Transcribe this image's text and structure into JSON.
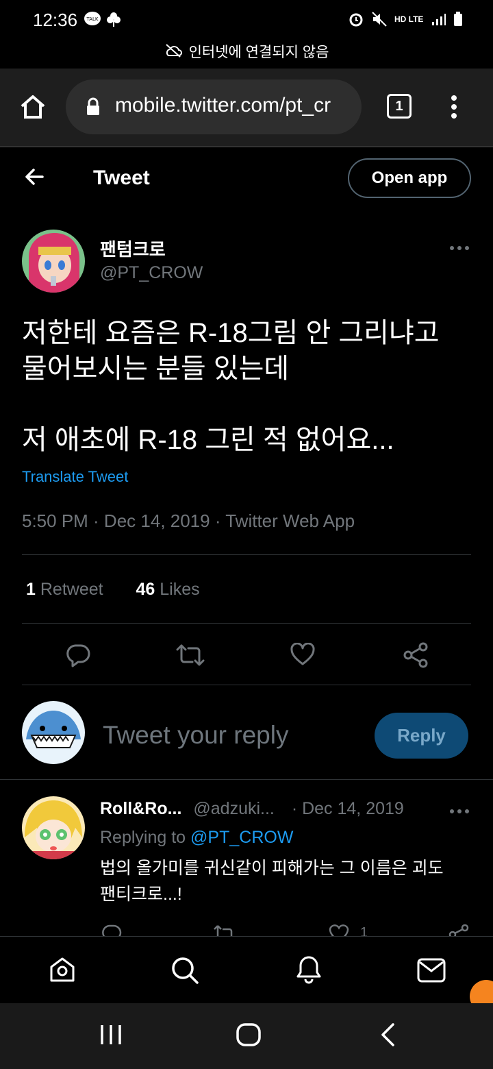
{
  "status_bar": {
    "time": "12:36",
    "network": "HD LTE"
  },
  "offline_banner": "인터넷에 연결되지 않음",
  "browser": {
    "url": "mobile.twitter.com/pt_cr",
    "tab_count": "1"
  },
  "header": {
    "title": "Tweet",
    "open_app": "Open app"
  },
  "tweet": {
    "display_name": "팬텀크로",
    "handle": "@PT_CROW",
    "text_line1": "저한테 요즘은 R-18그림 안 그리냐고",
    "text_line2": "물어보시는 분들 있는데",
    "text_line3": "저 애초에 R-18 그린 적 없어요...",
    "translate": "Translate Tweet",
    "meta": "5:50 PM · Dec 14, 2019 · Twitter Web App",
    "retweet_count": "1",
    "retweet_label": "Retweet",
    "like_count": "46",
    "like_label": "Likes"
  },
  "compose": {
    "placeholder": "Tweet your reply",
    "reply_button": "Reply"
  },
  "reply": {
    "display_name": "Roll&Ro...",
    "handle": "@adzuki...",
    "date": "· Dec 14, 2019",
    "replying_to_label": "Replying to",
    "replying_to_handle": "@PT_CROW",
    "text_line1": "법의 올가미를 귀신같이 피해가는 그 이름은 괴도",
    "text_line2": "팬티크로...!",
    "like_count": "1"
  },
  "colors": {
    "background": "#000000",
    "link": "#1d9bf0",
    "muted": "#71767b",
    "reply_button": "#0e4a75"
  },
  "icons": [
    "home-icon",
    "lock-icon",
    "tab-switcher-icon",
    "more-vertical-icon",
    "back-arrow-icon",
    "more-horizontal-icon",
    "reply-icon",
    "retweet-icon",
    "like-icon",
    "share-icon",
    "explore-icon",
    "search-icon",
    "notifications-icon",
    "messages-icon"
  ]
}
